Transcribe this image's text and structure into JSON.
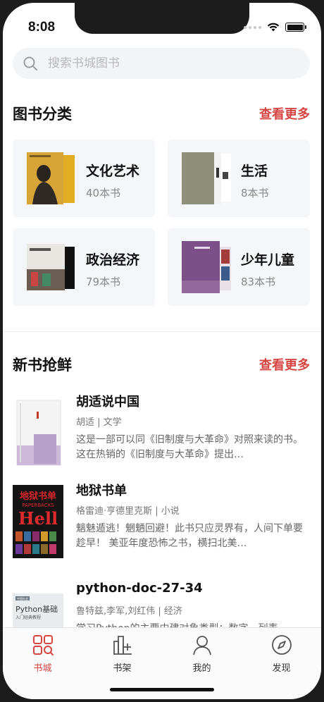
{
  "status_bar": {
    "time": "8:08"
  },
  "search": {
    "placeholder": "搜索书城图书"
  },
  "categories_section": {
    "title": "图书分类",
    "see_more": "查看更多",
    "items": [
      {
        "name": "文化艺术",
        "count": "40本书"
      },
      {
        "name": "生活",
        "count": "8本书"
      },
      {
        "name": "政治经济",
        "count": "79本书"
      },
      {
        "name": "少年儿童",
        "count": "83本书"
      }
    ]
  },
  "new_books_section": {
    "title": "新书抢鲜",
    "see_more": "查看更多",
    "books": [
      {
        "title": "胡适说中国",
        "meta": "胡适 | 文学",
        "description": "这是一部可以同《旧制度与大革命》对照来读的书。这在热销的《旧制度与大革命》提出…"
      },
      {
        "title": "地狱书单",
        "meta": "格雷迪·亨德里克斯 | 小说",
        "description": "魑魅遁逃！魍魉回避！此书只应灵界有，人间下单要趁早！ 美亚年度恐怖之书，横扫北美…"
      },
      {
        "title": "python-doc-27-34",
        "meta": "鲁特兹,李军,刘红伟 | 经济",
        "description": "学习Python的主要内建对象类型：数字、列表…"
      }
    ],
    "cover_texts": {
      "hell_cn": "地狱书单",
      "hell_en": "PAPERBACKS",
      "hell_big": "Hell",
      "python_badge": "中国社会",
      "python_title": "Python基础",
      "python_sub": "入门经典教程"
    }
  },
  "tabbar": {
    "tabs": [
      {
        "label": "书城",
        "icon": "bookstore-icon",
        "active": true
      },
      {
        "label": "书架",
        "icon": "bookshelf-icon",
        "active": false
      },
      {
        "label": "我的",
        "icon": "profile-icon",
        "active": false
      },
      {
        "label": "发现",
        "icon": "compass-icon",
        "active": false
      }
    ]
  },
  "colors": {
    "accent": "#d64541",
    "card_bg": "#f5f6f9",
    "search_bg": "#f3f4f8"
  }
}
